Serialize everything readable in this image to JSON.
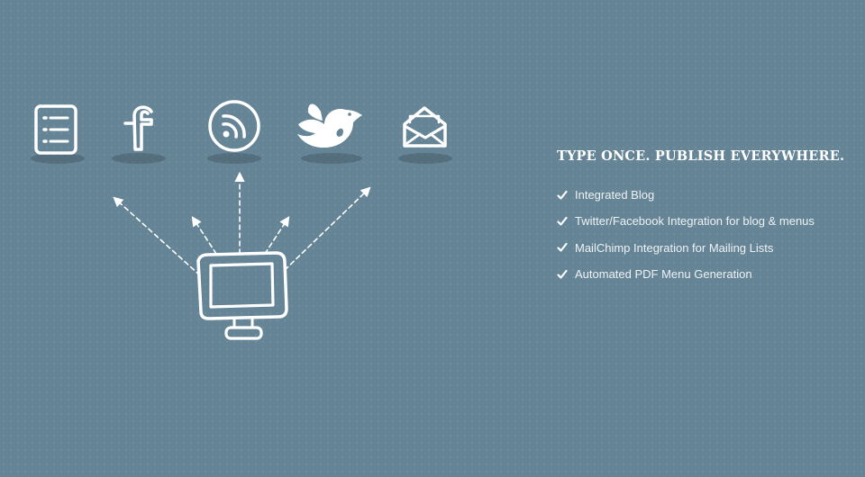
{
  "headline": "TYPE ONCE. PUBLISH EVERYWHERE.",
  "features": [
    {
      "label": "Integrated Blog",
      "icon": "checkmark-icon"
    },
    {
      "label": "Twitter/Facebook Integration for blog & menus",
      "icon": "checkmark-icon"
    },
    {
      "label": "MailChimp Integration for Mailing Lists",
      "icon": "checkmark-icon"
    },
    {
      "label": "Automated PDF Menu Generation",
      "icon": "checkmark-icon"
    }
  ],
  "illustration": {
    "top_icons": [
      "menu-list-icon",
      "facebook-icon",
      "rss-icon",
      "twitter-bird-icon",
      "email-icon"
    ],
    "source_icon": "computer-monitor-icon"
  },
  "colors": {
    "background": "#658495",
    "foreground": "#ffffff"
  }
}
